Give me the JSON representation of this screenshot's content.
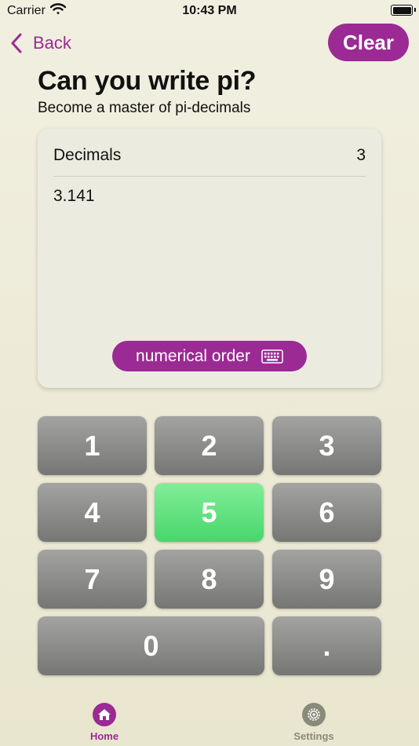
{
  "status_bar": {
    "carrier": "Carrier",
    "time": "10:43 PM"
  },
  "nav": {
    "back_label": "Back",
    "clear_label": "Clear"
  },
  "header": {
    "title": "Can you write pi?",
    "subtitle": "Become a master of pi-decimals"
  },
  "card": {
    "decimals_label": "Decimals",
    "decimals_count": "3",
    "digits": "3.141",
    "mode_label": "numerical order"
  },
  "keypad": {
    "keys": [
      "1",
      "2",
      "3",
      "4",
      "5",
      "6",
      "7",
      "8",
      "9",
      "0",
      "."
    ],
    "highlighted_key": "5"
  },
  "tabs": [
    {
      "label": "Home",
      "icon": "home-icon",
      "active": true
    },
    {
      "label": "Settings",
      "icon": "gear-icon",
      "active": false
    }
  ],
  "colors": {
    "accent": "#9b2a94",
    "highlight": "#4cd96e",
    "key": "#8c8c8a",
    "background": "#eeecd9"
  }
}
